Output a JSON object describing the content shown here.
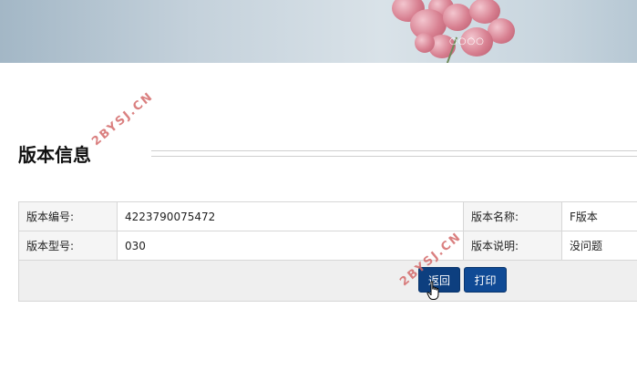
{
  "banner": {
    "indicator_dots": "○○○○"
  },
  "section": {
    "title": "版本信息"
  },
  "details": {
    "rows": [
      [
        {
          "label": "版本编号:",
          "value": "4223790075472"
        },
        {
          "label": "版本名称:",
          "value": "F版本"
        }
      ],
      [
        {
          "label": "版本型号:",
          "value": "030"
        },
        {
          "label": "版本说明:",
          "value": "没问题"
        }
      ]
    ]
  },
  "actions": {
    "back_label": "返回",
    "print_label": "打印"
  },
  "watermarks": [
    "2BYSJ.CN",
    "2BYSJ.CN"
  ],
  "colors": {
    "button_bg": "#0f4a95",
    "button_text": "#ffffff",
    "label_cell_bg": "#f5f5f5",
    "action_row_bg": "#efefef",
    "watermark": "#d46a6a"
  }
}
